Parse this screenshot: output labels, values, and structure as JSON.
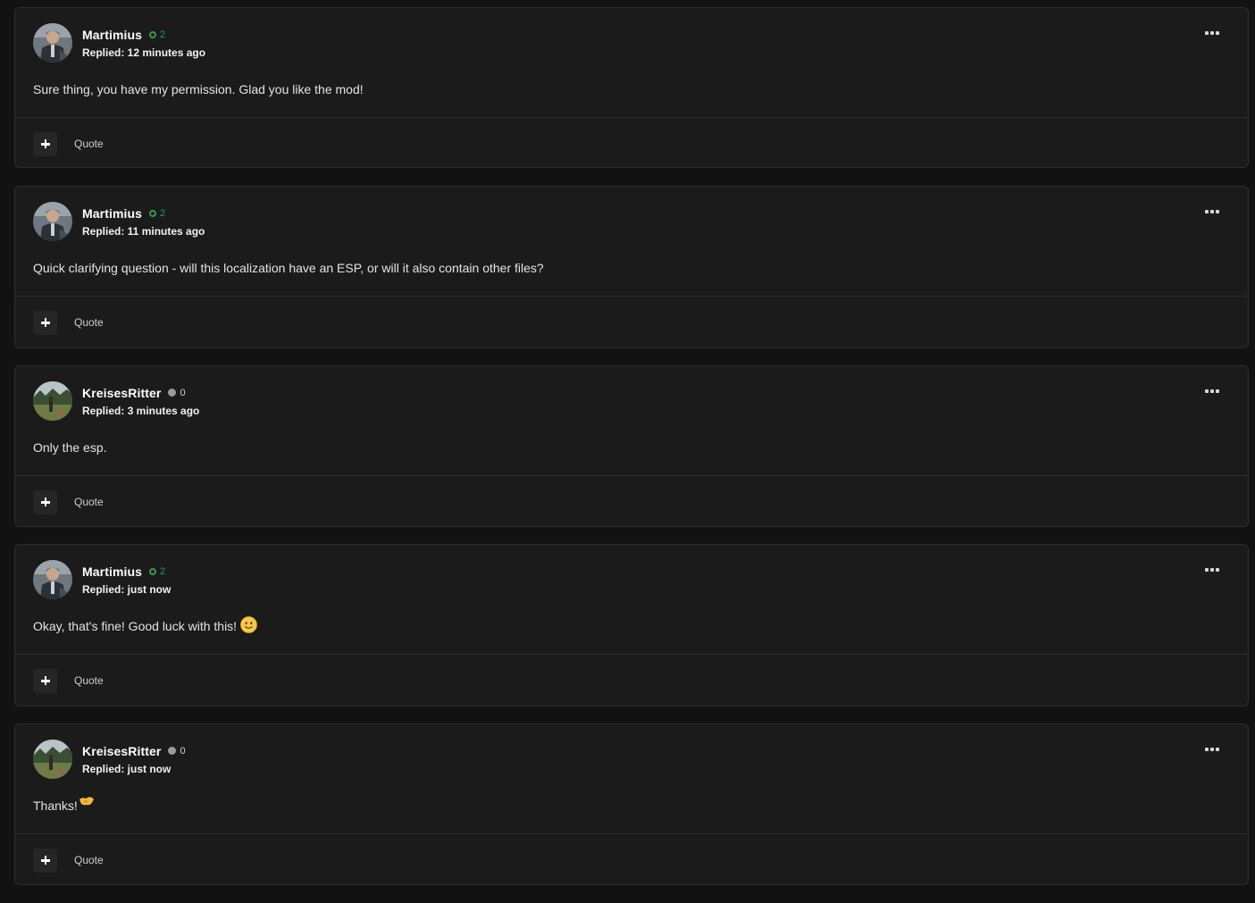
{
  "posts": [
    {
      "author": "Martimius",
      "reputation": "2",
      "rep_type": "positive",
      "avatar": "avatar-martimius",
      "replied": "Replied: 12 minutes ago",
      "body": "Sure thing, you have my permission. Glad you like the mod!",
      "emoji": "",
      "quote_label": "Quote"
    },
    {
      "author": "Martimius",
      "reputation": "2",
      "rep_type": "positive",
      "avatar": "avatar-martimius",
      "replied": "Replied: 11 minutes ago",
      "body": "Quick clarifying question - will this localization have an ESP, or will it also contain other files?",
      "emoji": "",
      "quote_label": "Quote"
    },
    {
      "author": "KreisesRitter",
      "reputation": "0",
      "rep_type": "neutral",
      "avatar": "avatar-kreisesritter",
      "replied": "Replied: 3 minutes ago",
      "body": "Only the esp.",
      "emoji": "",
      "quote_label": "Quote"
    },
    {
      "author": "Martimius",
      "reputation": "2",
      "rep_type": "positive",
      "avatar": "avatar-martimius",
      "replied": "Replied: just now",
      "body": "Okay, that's fine! Good luck with this!",
      "emoji": "slightly-smiling-face-icon",
      "quote_label": "Quote"
    },
    {
      "author": "KreisesRitter",
      "reputation": "0",
      "rep_type": "neutral",
      "avatar": "avatar-kreisesritter",
      "replied": "Replied: just now",
      "body": "Thanks!",
      "emoji": "handshake-icon",
      "quote_label": "Quote"
    }
  ],
  "icons": {
    "more": "more-options-icon",
    "react": "plus-icon"
  },
  "colors": {
    "background": "#121212",
    "card": "#1b1b1b",
    "border": "#2e2e2e",
    "rep_positive": "#2f9e4b",
    "rep_neutral": "#9a9a9a"
  }
}
